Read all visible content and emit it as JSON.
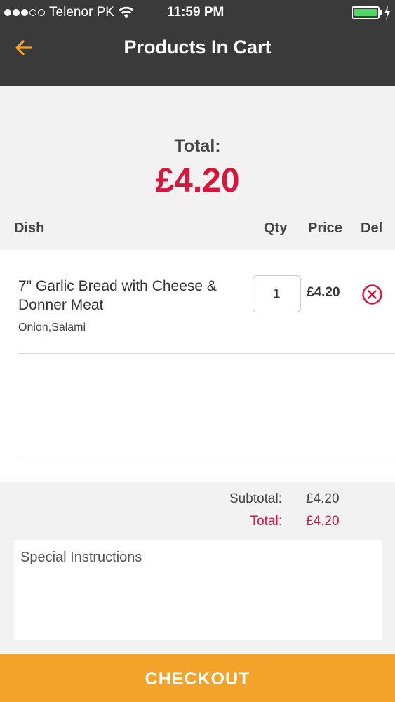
{
  "status_bar": {
    "carrier": "Telenor PK",
    "time": "11:59 PM"
  },
  "header": {
    "title": "Products In Cart",
    "back_icon": "back-arrow-icon",
    "accent": "#f3a22a",
    "background": "#3a3a3a"
  },
  "total": {
    "label": "Total:",
    "value": "£4.20",
    "color": "#d6163c"
  },
  "columns": {
    "dish": "Dish",
    "qty": "Qty",
    "price": "Price",
    "del": "Del"
  },
  "items": [
    {
      "name": "7\" Garlic Bread with Cheese & Donner Meat",
      "options": "Onion,Salami",
      "qty": "1",
      "price": "£4.20",
      "delete_icon": "remove-circle-icon"
    }
  ],
  "summary": {
    "subtotal_label": "Subtotal:",
    "subtotal_value": "£4.20",
    "total_label": "Total:",
    "total_value": "£4.20"
  },
  "instructions": {
    "placeholder": "Special Instructions"
  },
  "checkout": {
    "label": "CHECKOUT"
  }
}
